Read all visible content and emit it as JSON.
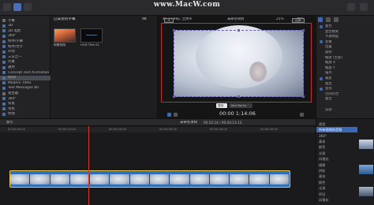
{
  "watermark": "www.MacW.com",
  "browser": {
    "title": "已安装的字幕",
    "resolution": "4K",
    "clips": [
      {
        "label": "刷爆视频"
      },
      {
        "label": "HUD Title 01"
      }
    ]
  },
  "viewer": {
    "format": "4K 23.98p, 立体声",
    "project": "未命名项目",
    "zoom": "25%",
    "display": "显示",
    "timecode": "00:00 1:14:06",
    "tab_active": "变形",
    "tab_other": "Ken Burns",
    "corner_left": "5",
    "corner_right": "还原"
  },
  "sidebar": {
    "items": [
      {
        "label": "字幕",
        "icon": "group-icon",
        "selected": false
      },
      {
        "label": "3D",
        "icon": "folder-icon",
        "selected": false
      },
      {
        "label": "3D 电影",
        "icon": "folder-icon",
        "selected": false
      },
      {
        "label": "360°",
        "icon": "folder-icon",
        "selected": false
      },
      {
        "label": "构件/字幕",
        "icon": "folder-icon",
        "selected": false
      },
      {
        "label": "构件/文字",
        "icon": "folder-icon",
        "selected": false
      },
      {
        "label": "开场",
        "icon": "folder-icon",
        "selected": false
      },
      {
        "label": "三分之一",
        "icon": "folder-icon",
        "selected": false
      },
      {
        "label": "片尾",
        "icon": "folder-icon",
        "selected": false
      },
      {
        "label": "通用",
        "icon": "folder-icon",
        "selected": false
      },
      {
        "label": "Concept Text Animation",
        "icon": "folder-icon",
        "selected": false
      },
      {
        "label": "HUD",
        "icon": "folder-icon",
        "selected": true
      },
      {
        "label": "Modern Titles",
        "icon": "folder-icon",
        "selected": false
      },
      {
        "label": "Text Messages 80",
        "icon": "folder-icon",
        "selected": false
      },
      {
        "label": "发生器",
        "icon": "group-icon",
        "selected": false
      },
      {
        "label": "360°",
        "icon": "folder-icon",
        "selected": false
      },
      {
        "label": "背景",
        "icon": "folder-icon",
        "selected": false
      },
      {
        "label": "单色",
        "icon": "folder-icon",
        "selected": false
      },
      {
        "label": "纹理",
        "icon": "folder-icon",
        "selected": false
      }
    ]
  },
  "inspector": {
    "rows": [
      {
        "label": "复合",
        "icon": "blend-icon"
      },
      {
        "label": "混合模式",
        "icon": ""
      },
      {
        "label": "不透明度",
        "icon": ""
      },
      {
        "label": "变换",
        "icon": "transform-icon"
      },
      {
        "label": "位置",
        "icon": ""
      },
      {
        "label": "旋转",
        "icon": ""
      },
      {
        "label": "缩放 (全部)",
        "icon": ""
      },
      {
        "label": "缩放 X",
        "icon": ""
      },
      {
        "label": "缩放 Y",
        "icon": ""
      },
      {
        "label": "锚点",
        "icon": ""
      },
      {
        "label": "裁剪",
        "icon": "crop-icon"
      },
      {
        "label": "类型",
        "icon": ""
      },
      {
        "label": "变形",
        "icon": "distort-icon"
      },
      {
        "label": "空间符合",
        "icon": ""
      },
      {
        "label": "类型",
        "icon": ""
      },
      {
        "label": "",
        "icon": ""
      },
      {
        "label": "渲染",
        "icon": ""
      },
      {
        "label": "",
        "icon": ""
      }
    ]
  },
  "timeline": {
    "index_label": "索引",
    "project": "未命名项目",
    "duration": "00:22:14 / 00:24:13:13",
    "ruler": [
      "00:00:00:00",
      "00:00:10:00",
      "00:00:20:00",
      "00:00:30:00",
      "00:00:40:00",
      "00:00:50:00"
    ]
  },
  "effects": {
    "items": [
      {
        "label": "视频",
        "selected": false
      },
      {
        "label": "所有视频和音频",
        "selected": true
      },
      {
        "label": "360°",
        "selected": false
      },
      {
        "label": "基本",
        "selected": false
      },
      {
        "label": "颜色",
        "selected": false
      },
      {
        "label": "光源",
        "selected": false
      },
      {
        "label": "风格化",
        "selected": false
      },
      {
        "label": "模糊",
        "selected": false
      },
      {
        "label": "拼贴",
        "selected": false
      },
      {
        "label": "基本",
        "selected": false
      },
      {
        "label": "颜色",
        "selected": false
      },
      {
        "label": "光源",
        "selected": false
      },
      {
        "label": "怀旧",
        "selected": false
      },
      {
        "label": "风格化",
        "selected": false
      }
    ]
  },
  "colors": {
    "accent_blue": "#3b69b6",
    "selection_red": "#d0272a",
    "clip_blue": "#2f6fb5",
    "clip_border": "#e8c64a"
  }
}
